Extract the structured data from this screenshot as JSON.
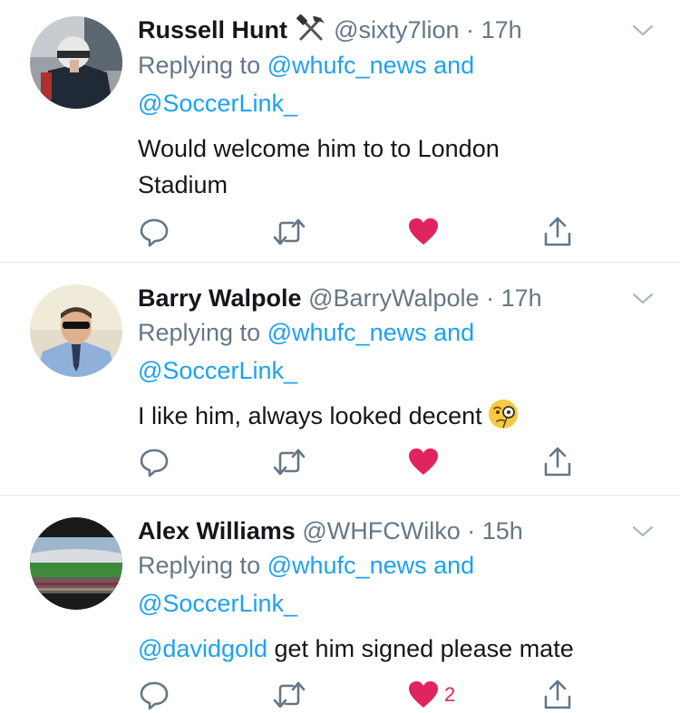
{
  "colors": {
    "link": "#1da1f2",
    "muted": "#657786",
    "like": "#e0245e",
    "divider": "#e1e8ed"
  },
  "tweets": [
    {
      "name": "Russell Hunt",
      "name_icon": "hammer-and-pick-icon",
      "handle": "@sixty7lion",
      "dot": "·",
      "time": "17h",
      "replying_prefix": "Replying to",
      "mention1": "@whufc_news",
      "and_word": "and",
      "mention2": "@SoccerLink_",
      "text": "Would welcome him to to London Stadium",
      "liked": true,
      "like_count": ""
    },
    {
      "name": "Barry Walpole",
      "handle": "@BarryWalpole",
      "dot": "·",
      "time": "17h",
      "replying_prefix": "Replying to",
      "mention1": "@whufc_news",
      "and_word": "and",
      "mention2": "@SoccerLink_",
      "text": "I like him, always looked decent",
      "text_emoji": "face-with-monocle-icon",
      "liked": true,
      "like_count": ""
    },
    {
      "name": "Alex Williams",
      "handle": "@WHFCWilko",
      "dot": "·",
      "time": "15h",
      "replying_prefix": "Replying to",
      "mention1": "@whufc_news",
      "and_word": "and",
      "mention2": "@SoccerLink_",
      "text_mention": "@davidgold",
      "text": " get him signed please mate",
      "liked": true,
      "like_count": "2"
    }
  ]
}
